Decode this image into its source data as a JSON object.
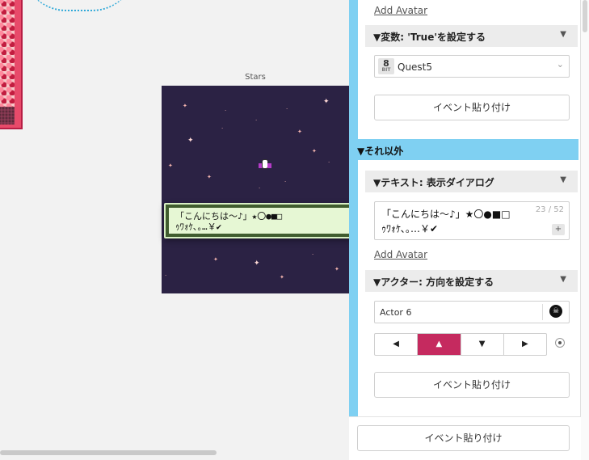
{
  "canvas": {
    "scene_name": "Stars",
    "dialog_text": "「こんにちは〜♪」★〇●■□\nｩﾜｫｹ､｡…￥✔"
  },
  "top_block": {
    "add_avatar": "Add Avatar",
    "event_title": "▼変数: 'True'を設定する",
    "variable_badge_num": "8",
    "variable_badge_label": "BIT",
    "variable_value": "Quest5",
    "paste_button": "イベント貼り付け"
  },
  "else_block": {
    "header": "▼それ以外",
    "text_event_title": "▼テキスト: 表示ダイアログ",
    "text_value_line1": "「こんにちは〜♪」★〇●■□",
    "text_value_line2": "ｩﾜｫｹ､｡…￥✔",
    "char_count": "23 / 52",
    "plus_label": "+",
    "add_avatar": "Add Avatar",
    "actor_event_title": "▼アクター: 方向を設定する",
    "actor_value": "Actor 6",
    "directions": [
      "◀",
      "▲",
      "▼",
      "▶"
    ],
    "active_direction": "▲",
    "paste_button": "イベント貼り付け"
  },
  "footer": {
    "paste_button": "イベント貼り付け"
  },
  "icons": {
    "collapse": "▼",
    "dropdown": "chevron-down-icon",
    "actor": "skull-icon"
  },
  "colors": {
    "branch_accent": "#7fd0f2",
    "active_direction": "#c52a5f",
    "scene_bg": "#2b2244",
    "dialog_bg": "#e6f7d4"
  }
}
